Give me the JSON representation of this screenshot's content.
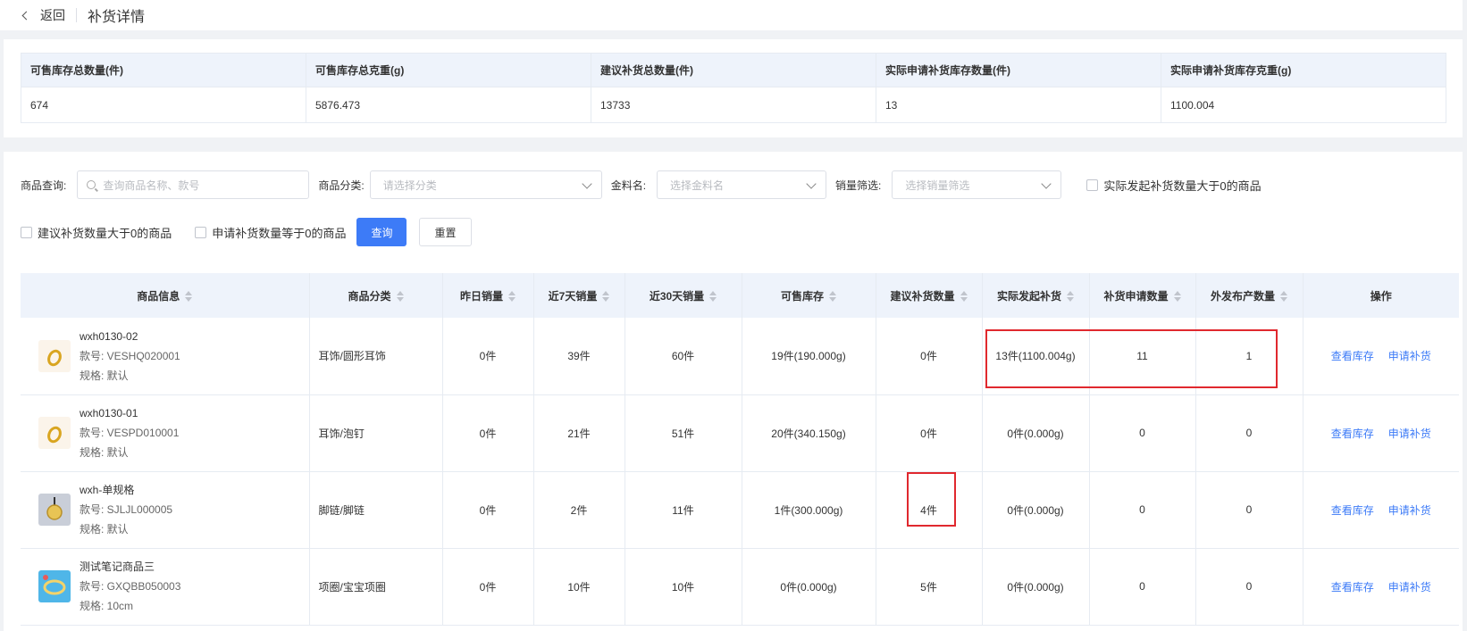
{
  "header": {
    "back_label": "返回",
    "page_title": "补货详情"
  },
  "summary": {
    "headers": [
      "可售库存总数量(件)",
      "可售库存总克重(g)",
      "建议补货总数量(件)",
      "实际申请补货库存数量(件)",
      "实际申请补货库存克重(g)"
    ],
    "values": [
      "674",
      "5876.473",
      "13733",
      "13",
      "1100.004"
    ]
  },
  "filters": {
    "product_query_label": "商品查询:",
    "product_query_placeholder": "查询商品名称、款号",
    "category_label": "商品分类:",
    "category_placeholder": "请选择分类",
    "material_label": "金料名:",
    "material_placeholder": "选择金料名",
    "sales_label": "销量筛选:",
    "sales_placeholder": "选择销量筛选",
    "check_actual_gt0": "实际发起补货数量大于0的商品",
    "check_suggest_gt0": "建议补货数量大于0的商品",
    "check_apply_eq0": "申请补货数量等于0的商品",
    "query_button": "查询",
    "reset_button": "重置"
  },
  "table": {
    "columns": [
      "商品信息",
      "商品分类",
      "昨日销量",
      "近7天销量",
      "近30天销量",
      "可售库存",
      "建议补货数量",
      "实际发起补货",
      "补货申请数量",
      "外发布产数量",
      "操作"
    ],
    "rows": [
      {
        "name": "wxh0130-02",
        "sku": "款号: VESHQ020001",
        "spec": "规格: 默认",
        "thumb": "ring-gold-icon",
        "category": "耳饰/圆形耳饰",
        "yesterday": "0件",
        "d7": "39件",
        "d30": "60件",
        "stock": "19件(190.000g)",
        "suggest": "0件",
        "actual": "13件(1100.004g)",
        "apply": "11",
        "outsource": "1"
      },
      {
        "name": "wxh0130-01",
        "sku": "款号: VESPD010001",
        "spec": "规格: 默认",
        "thumb": "ring-gold-icon",
        "category": "耳饰/泡钉",
        "yesterday": "0件",
        "d7": "21件",
        "d30": "51件",
        "stock": "20件(340.150g)",
        "suggest": "0件",
        "actual": "0件(0.000g)",
        "apply": "0",
        "outsource": "0"
      },
      {
        "name": "wxh-单规格",
        "sku": "款号: SJLJL000005",
        "spec": "规格: 默认",
        "thumb": "pendant-icon",
        "category": "脚链/脚链",
        "yesterday": "0件",
        "d7": "2件",
        "d30": "11件",
        "stock": "1件(300.000g)",
        "suggest": "4件",
        "actual": "0件(0.000g)",
        "apply": "0",
        "outsource": "0"
      },
      {
        "name": "测试笔记商品三",
        "sku": "款号: GXQBB050003",
        "spec": "规格: 10cm",
        "thumb": "bracelet-blue-icon",
        "category": "项圈/宝宝项圈",
        "yesterday": "0件",
        "d7": "10件",
        "d30": "10件",
        "stock": "0件(0.000g)",
        "suggest": "5件",
        "actual": "0件(0.000g)",
        "apply": "0",
        "outsource": "0"
      }
    ],
    "actions": {
      "view_stock": "查看库存",
      "apply_restock": "申请补货"
    }
  },
  "colors": {
    "accent": "#3d7bf7",
    "highlight": "#e0282e",
    "header_bg": "#eef3fb"
  }
}
